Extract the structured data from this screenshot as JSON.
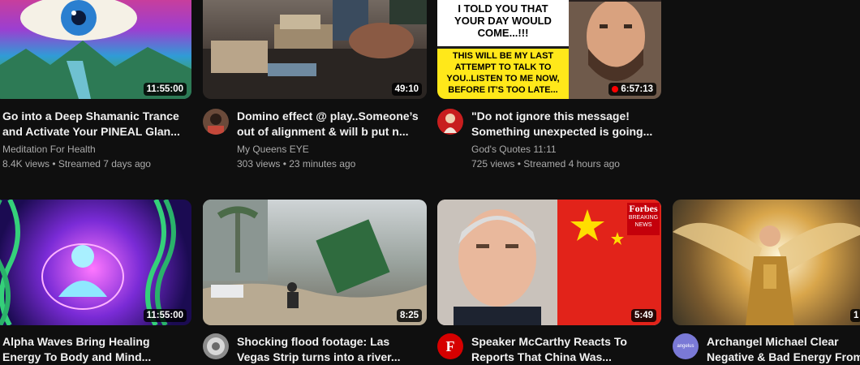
{
  "videos": [
    {
      "title1": "Go into a Deep Shamanic Trance",
      "title2": "and Activate Your PINEAL Glan...",
      "channel": "Meditation For Health",
      "meta": "8.4K views • Streamed 7 days ago",
      "duration": "11:55:00"
    },
    {
      "title1": "Domino effect @ play..Someone’s",
      "title2": "out of alignment & will b put n...",
      "channel": "My Queens EYE",
      "meta": "303 views • 23 minutes ago",
      "duration": "49:10"
    },
    {
      "title1": "\"Do not ignore this message!",
      "title2": "Something unexpected is going...",
      "channel": "God's Quotes 11:11",
      "meta": "725 views • Streamed 4 hours ago",
      "duration": "6:57:13",
      "thumb_text_top": [
        "I TOLD YOU THAT",
        "YOUR DAY WOULD",
        "COME...!!!"
      ],
      "thumb_text_bottom": [
        "THIS WILL BE MY LAST",
        "ATTEMPT TO TALK TO",
        "YOU..LISTEN TO ME NOW,",
        "BEFORE IT'S TOO LATE..."
      ]
    },
    {
      "title1": "Alpha Waves Bring Healing",
      "title2": "Energy To Body and Mind...",
      "duration": "11:55:00"
    },
    {
      "title1": "Shocking flood footage: Las",
      "title2": "Vegas Strip turns into a river...",
      "duration": "8:25"
    },
    {
      "title1": "Speaker McCarthy Reacts To",
      "title2": "Reports That China Was...",
      "duration": "5:49",
      "badge_brand": "Forbes",
      "badge_sub": [
        "BREAKING",
        "NEWS"
      ],
      "avatar_letter": "F"
    },
    {
      "title1": "Archangel Michael Clear",
      "title2": "Negative & Bad Energy From...",
      "duration": "1",
      "avatar_text": "angelus"
    }
  ]
}
